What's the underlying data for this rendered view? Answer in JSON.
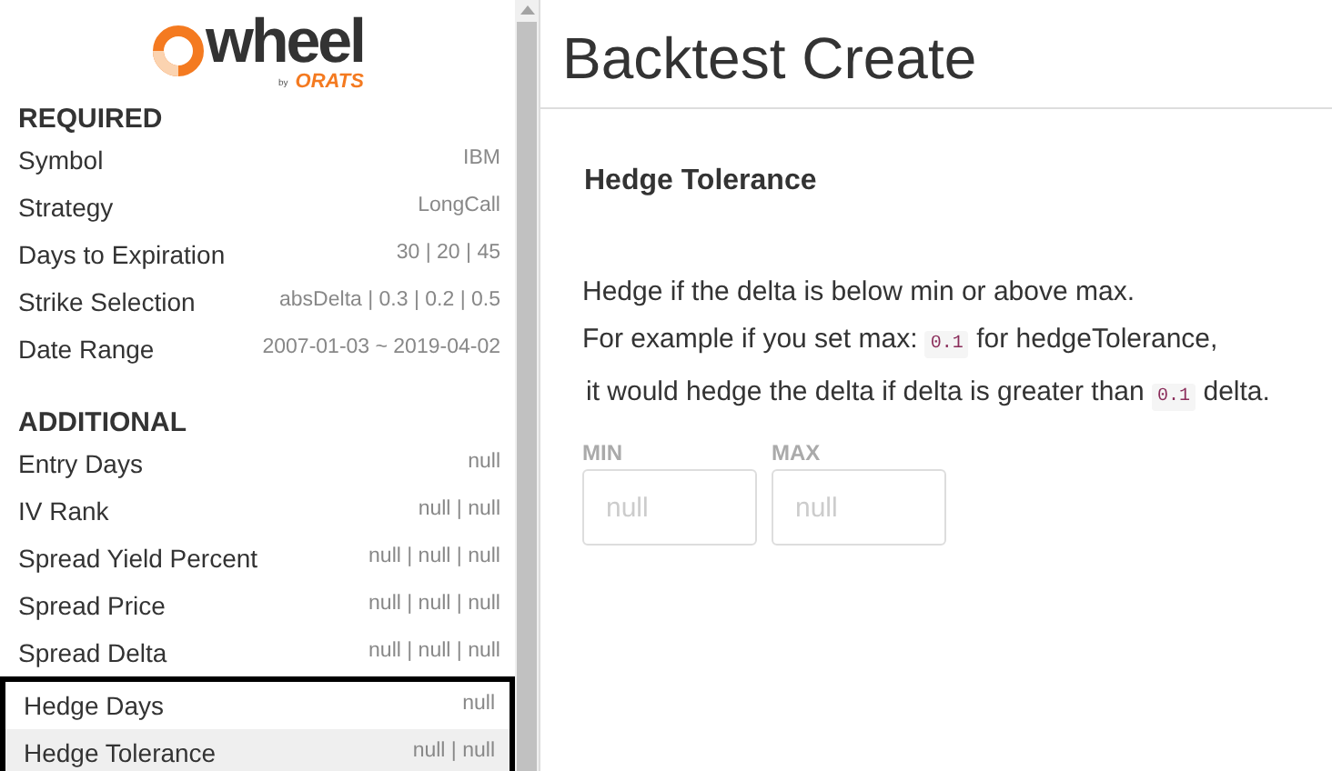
{
  "logo": {
    "name": "wheel",
    "by": "by",
    "brand": "ORATS"
  },
  "sidebar": {
    "sections": [
      {
        "title": "REQUIRED",
        "items": [
          {
            "label": "Symbol",
            "value": "IBM",
            "selected": false,
            "framed": false
          },
          {
            "label": "Strategy",
            "value": "LongCall",
            "selected": false,
            "framed": false
          },
          {
            "label": "Days to Expiration",
            "value": "30 | 20 | 45",
            "selected": false,
            "framed": false
          },
          {
            "label": "Strike Selection",
            "value": "absDelta | 0.3 | 0.2 | 0.5",
            "selected": false,
            "framed": false
          },
          {
            "label": "Date Range",
            "value": "2007-01-03 ~ 2019-04-02",
            "selected": false,
            "framed": false
          }
        ]
      },
      {
        "title": "ADDITIONAL",
        "items": [
          {
            "label": "Entry Days",
            "value": "null",
            "selected": false,
            "framed": false
          },
          {
            "label": "IV Rank",
            "value": "null | null",
            "selected": false,
            "framed": false
          },
          {
            "label": "Spread Yield Percent",
            "value": "null | null | null",
            "selected": false,
            "framed": false
          },
          {
            "label": "Spread Price",
            "value": "null | null | null",
            "selected": false,
            "framed": false
          },
          {
            "label": "Spread Delta",
            "value": "null | null | null",
            "selected": false,
            "framed": false
          },
          {
            "label": "Hedge Days",
            "value": "null",
            "selected": false,
            "framed": true
          },
          {
            "label": "Hedge Tolerance",
            "value": "null | null",
            "selected": true,
            "framed": true
          }
        ]
      }
    ]
  },
  "main": {
    "title": "Backtest Create",
    "section_title": "Hedge Tolerance",
    "lines": [
      [
        {
          "kind": "text",
          "text": "Hedge if the delta is below min or above max."
        }
      ],
      [
        {
          "kind": "text",
          "text": "For example if you set max: "
        },
        {
          "kind": "code",
          "text": "0.1"
        },
        {
          "kind": "text",
          "text": " for hedgeTolerance,"
        }
      ],
      [
        {
          "kind": "text",
          "text": "it would hedge the delta if delta is greater than "
        },
        {
          "kind": "code",
          "text": "0.1"
        },
        {
          "kind": "text",
          "text": " delta."
        }
      ]
    ],
    "fields": [
      {
        "label": "MIN",
        "placeholder": "null"
      },
      {
        "label": "MAX",
        "placeholder": "null"
      }
    ]
  }
}
